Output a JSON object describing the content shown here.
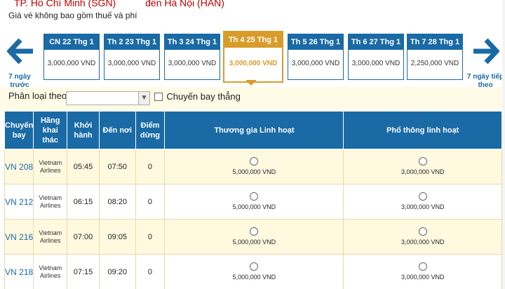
{
  "route": {
    "from": "TP. Hồ Chí Minh (SGN)",
    "to": "đến Hà Nội (HAN)"
  },
  "note": "Giá vé không bao gồm thuế và phí",
  "nav": {
    "prev_label": "7 ngày trước",
    "next_label": "7 ngày tiếp theo"
  },
  "days": [
    {
      "label": "CN 22 Thg 1",
      "price": "3,000,000 VND",
      "selected": false
    },
    {
      "label": "Th 2 23 Thg 1",
      "price": "3,000,000 VND",
      "selected": false
    },
    {
      "label": "Th 3 24 Thg 1",
      "price": "3,000,000 VND",
      "selected": false
    },
    {
      "label": "Th 4 25 Thg 1",
      "price": "3,000,000 VND",
      "selected": true
    },
    {
      "label": "Th 5 26 Thg 1",
      "price": "3,000,000 VND",
      "selected": false
    },
    {
      "label": "Th 6 27 Thg 1",
      "price": "3,000,000 VND",
      "selected": false
    },
    {
      "label": "Th 7 28 Thg 1",
      "price": "2,250,000 VND",
      "selected": false
    }
  ],
  "filter": {
    "label": "Phân loại theo",
    "selected": "",
    "direct_label": "Chuyến bay thẳng"
  },
  "columns": {
    "flight": "Chuyến bay",
    "airline": "Hãng khai thác",
    "depart": "Khởi hành",
    "arrive": "Đến nơi",
    "stops": "Điểm dừng",
    "business": "Thương gia Linh hoạt",
    "economy": "Phổ thông linh hoạt"
  },
  "flights": [
    {
      "no": "VN 208",
      "airline": "Vietnam Airlines",
      "depart": "05:45",
      "arrive": "07:50",
      "stops": "0",
      "business": "5,000,000 VND",
      "economy": "3,000,000 VND"
    },
    {
      "no": "VN 212",
      "airline": "Vietnam Airlines",
      "depart": "06:15",
      "arrive": "08:20",
      "stops": "0",
      "business": "5,000,000 VND",
      "economy": "3,000,000 VND"
    },
    {
      "no": "VN 216",
      "airline": "Vietnam Airlines",
      "depart": "07:00",
      "arrive": "09:05",
      "stops": "0",
      "business": "5,000,000 VND",
      "economy": "3,000,000 VND"
    },
    {
      "no": "VN 218",
      "airline": "Vietnam Airlines",
      "depart": "07:15",
      "arrive": "09:20",
      "stops": "0",
      "business": "5,000,000 VND",
      "economy": "3,000,000 VND"
    }
  ],
  "colors": {
    "header_blue": "#1a6aa5",
    "selected_gold": "#d89c2a",
    "route_red": "#c00000",
    "row_cream": "#fff9e0"
  }
}
